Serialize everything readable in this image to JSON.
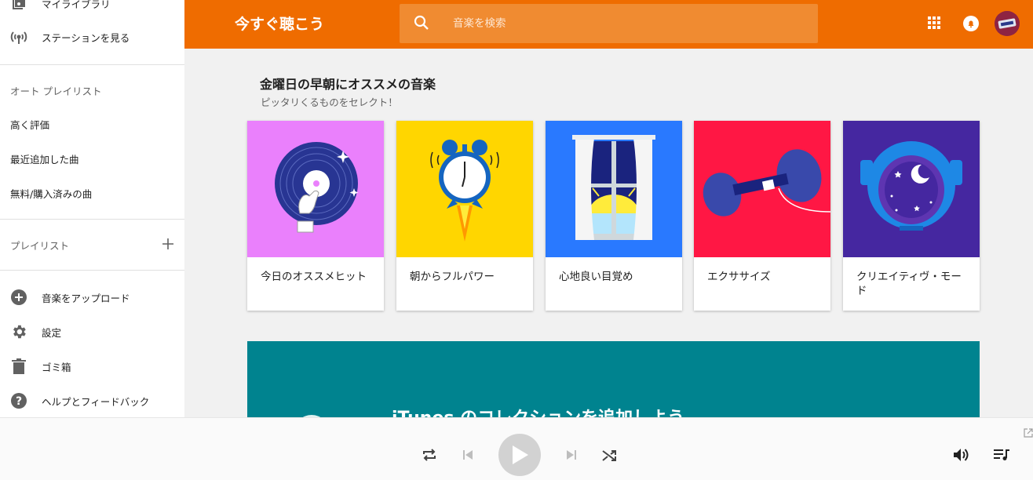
{
  "sidebar": {
    "my_library": "マイライブラリ",
    "stations": "ステーションを見る",
    "auto_playlists_header": "オート プレイリスト",
    "auto_items": [
      "高く評価",
      "最近追加した曲",
      "無料/購入済みの曲"
    ],
    "playlists_header": "プレイリスト",
    "add_playlist_icon": "+",
    "upload": "音楽をアップロード",
    "settings": "設定",
    "trash": "ゴミ箱",
    "help": "ヘルプとフィードバック"
  },
  "header": {
    "title": "今すぐ聴こう",
    "search_placeholder": "音楽を検索",
    "brand_color": "#ef6c00"
  },
  "main": {
    "section_title": "金曜日の早朝にオススメの音楽",
    "section_subtitle": "ピッタリくるものをセレクト！",
    "cards": [
      {
        "label": "今日のオススメヒット",
        "bg": "#ea80fc",
        "art": "vinyl-record"
      },
      {
        "label": "朝からフルパワー",
        "bg": "#ffd600",
        "art": "alarm-clock-rocket"
      },
      {
        "label": "心地良い目覚め",
        "bg": "#2979ff",
        "art": "window-sunrise"
      },
      {
        "label": "エクササイズ",
        "bg": "#ff1744",
        "art": "dumbbell"
      },
      {
        "label": "クリエイティヴ・モード",
        "bg": "#4527a0",
        "art": "astronaut-helmet"
      }
    ],
    "promo": {
      "title": "iTunes のコレクションを追加しよう",
      "bg": "#00838f"
    }
  },
  "player": {
    "icons": [
      "repeat-icon",
      "previous-icon",
      "play-icon",
      "next-icon",
      "shuffle-icon",
      "volume-icon",
      "queue-icon",
      "popout-icon"
    ]
  }
}
